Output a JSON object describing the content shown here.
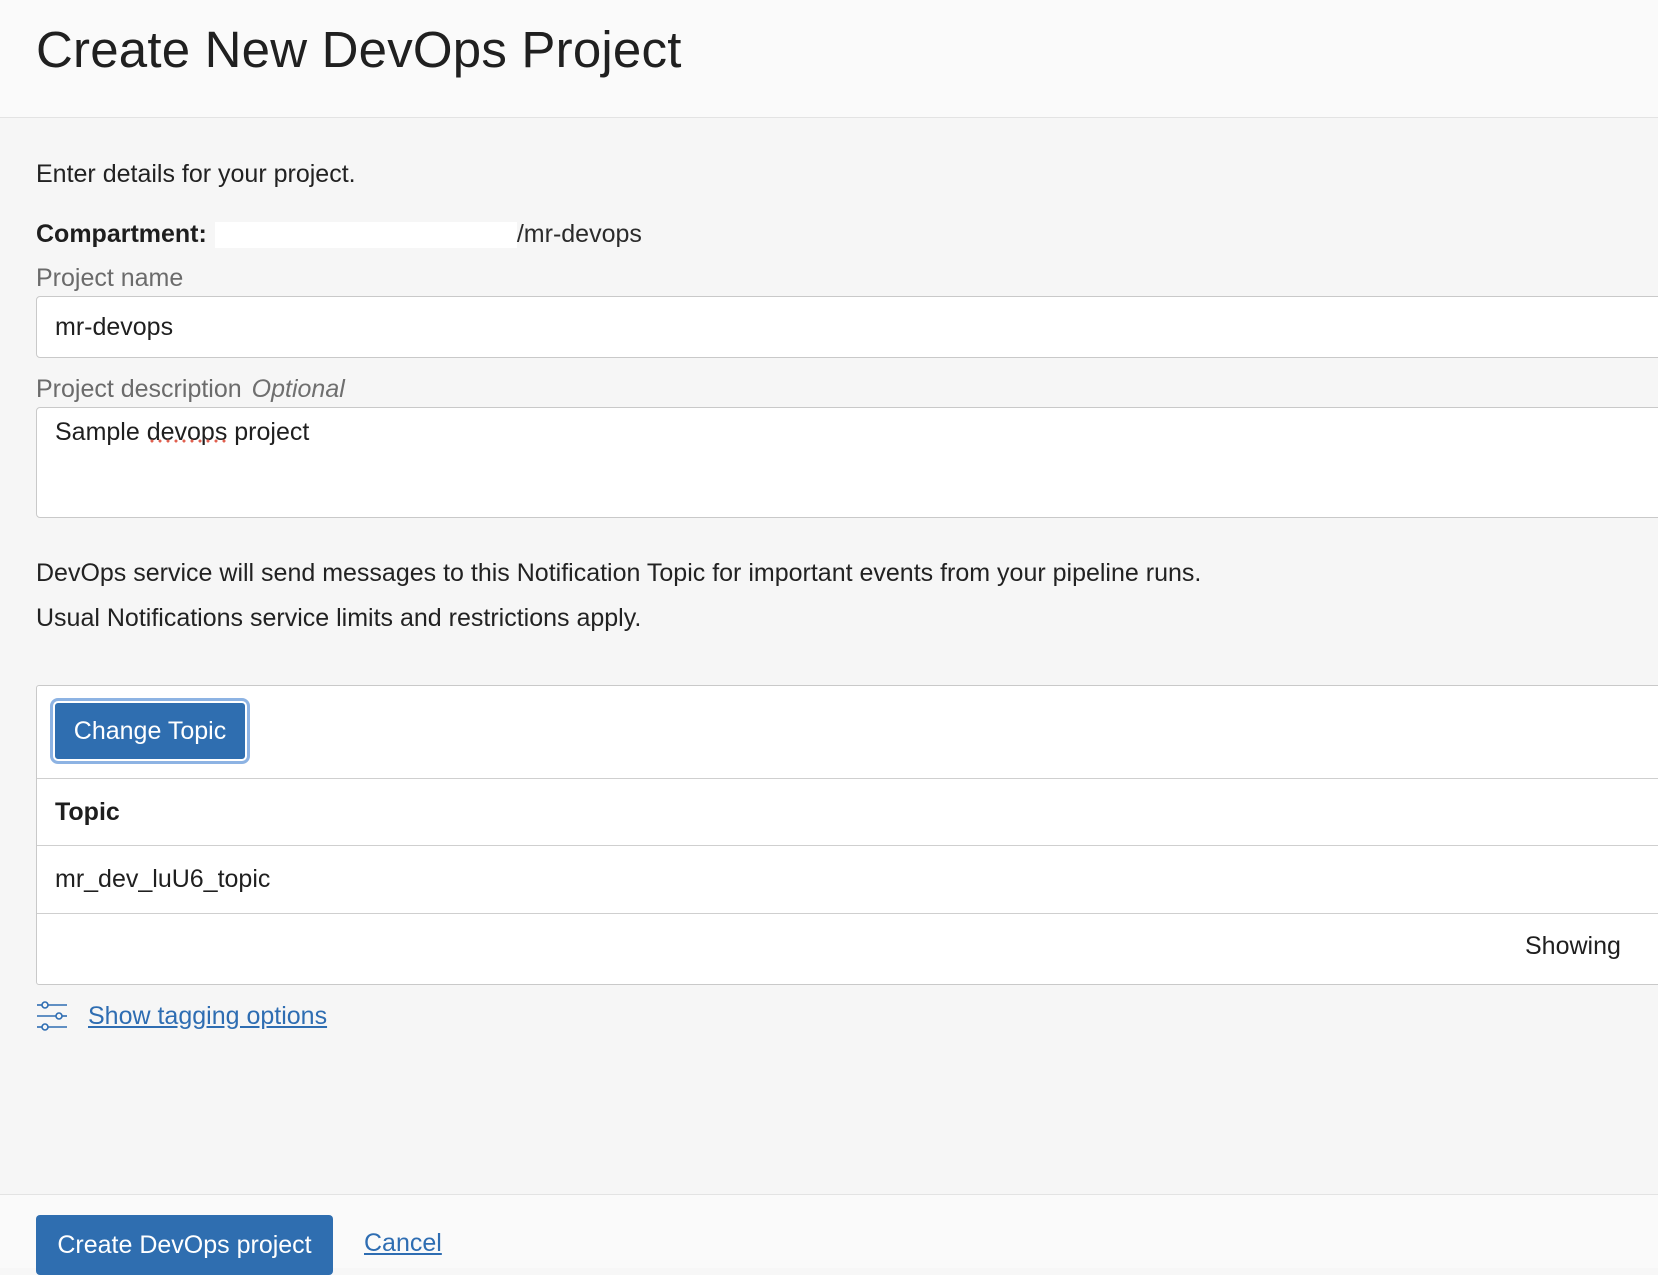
{
  "header": {
    "title": "Create New DevOps Project"
  },
  "form": {
    "intro": "Enter details for your project.",
    "compartment": {
      "label": "Compartment:",
      "path": "/mr-devops"
    },
    "project_name": {
      "label": "Project name",
      "value": "mr-devops"
    },
    "project_description": {
      "label": "Project description",
      "optional_label": "Optional",
      "value": "Sample devops project"
    },
    "notification_info": "DevOps service will send messages to this Notification Topic for important events from your pipeline runs.",
    "notification_limits": "Usual Notifications service limits and restrictions apply.",
    "topic_panel": {
      "change_topic_label": "Change Topic",
      "column_header": "Topic",
      "rows": [
        {
          "topic": "mr_dev_luU6_topic"
        }
      ],
      "pagination_text": "Showing"
    },
    "tagging_link": "Show tagging options"
  },
  "footer": {
    "create_label": "Create DevOps project",
    "cancel_label": "Cancel"
  },
  "colors": {
    "primary_button": "#2f6eb0",
    "link": "#2e6db2",
    "background": "#f6f6f6"
  },
  "icons": {
    "tagging": "sliders-icon"
  }
}
